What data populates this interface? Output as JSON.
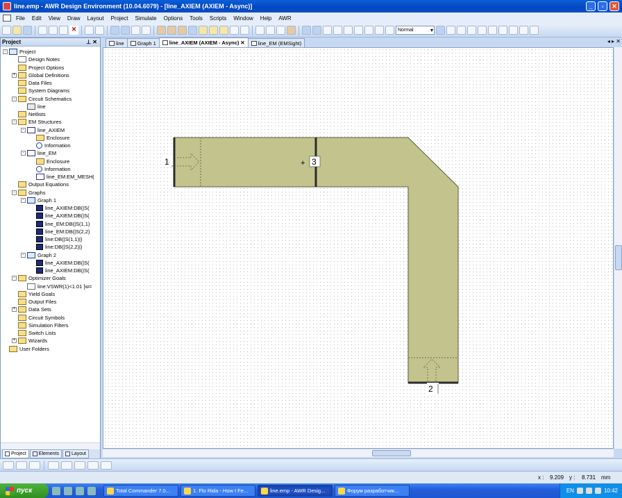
{
  "window": {
    "title": "line.emp - AWR Design Environment (10.04.6079) - [line_AXIEM (AXIEM - Async)]"
  },
  "menubar": {
    "items": [
      "File",
      "Edit",
      "View",
      "Draw",
      "Layout",
      "Project",
      "Simulate",
      "Options",
      "Tools",
      "Scripts",
      "Window",
      "Help",
      "AWR"
    ]
  },
  "toolbar": {
    "view_mode": "Normal"
  },
  "project_pane": {
    "title": "Project",
    "tree": [
      {
        "label": "Project",
        "icon": "project-icon"
      },
      {
        "label": "Design Notes",
        "icon": "doc-icon"
      },
      {
        "label": "Project Options",
        "icon": "folder-icon"
      },
      {
        "label": "Global Definitions",
        "icon": "folder-icon"
      },
      {
        "label": "Data Files",
        "icon": "folder-icon"
      },
      {
        "label": "System Diagrams",
        "icon": "folder-icon"
      },
      {
        "label": "Circuit Schematics",
        "icon": "folder-icon"
      },
      {
        "label": "line",
        "icon": "schematic-icon"
      },
      {
        "label": "Netlists",
        "icon": "folder-icon"
      },
      {
        "label": "EM Structures",
        "icon": "folder-icon"
      },
      {
        "label": "line_AXIEM",
        "icon": "em-icon"
      },
      {
        "label": "Enclosure",
        "icon": "folder-icon"
      },
      {
        "label": "Information",
        "icon": "info-icon"
      },
      {
        "label": "line_EM",
        "icon": "em-icon"
      },
      {
        "label": "Enclosure",
        "icon": "folder-icon"
      },
      {
        "label": "Information",
        "icon": "info-icon"
      },
      {
        "label": "line_EM:EM_MESH(",
        "icon": "em-icon"
      },
      {
        "label": "Output Equations",
        "icon": "folder-icon"
      },
      {
        "label": "Graphs",
        "icon": "folder-icon"
      },
      {
        "label": "Graph 1",
        "icon": "graph-icon"
      },
      {
        "label": "line_AXIEM:DB(|S(",
        "icon": "trace-icon"
      },
      {
        "label": "line_AXIEM:DB(|S(",
        "icon": "trace-icon"
      },
      {
        "label": "line_EM:DB(|S(1,1)",
        "icon": "trace-icon"
      },
      {
        "label": "line_EM:DB(|S(2,2)",
        "icon": "trace-icon"
      },
      {
        "label": "line:DB(|S(1,1)|)",
        "icon": "trace-icon"
      },
      {
        "label": "line:DB(|S(2,2)|)",
        "icon": "trace-icon"
      },
      {
        "label": "Graph 2",
        "icon": "graph-icon"
      },
      {
        "label": "line_AXIEM:DB(|S(",
        "icon": "trace-icon"
      },
      {
        "label": "line_AXIEM:DB(|S(",
        "icon": "trace-icon"
      },
      {
        "label": "Optimizer Goals",
        "icon": "folder-icon"
      },
      {
        "label": "line:VSWR(1)<1.01 [w=",
        "icon": "goal-icon"
      },
      {
        "label": "Yield Goals",
        "icon": "folder-icon"
      },
      {
        "label": "Output Files",
        "icon": "folder-icon"
      },
      {
        "label": "Data Sets",
        "icon": "folder-icon"
      },
      {
        "label": "Circuit Symbols",
        "icon": "folder-icon"
      },
      {
        "label": "Simulation Filters",
        "icon": "folder-icon"
      },
      {
        "label": "Switch Lists",
        "icon": "folder-icon"
      },
      {
        "label": "Wizards",
        "icon": "folder-icon"
      },
      {
        "label": "User Folders",
        "icon": "folder-icon"
      }
    ],
    "tabs": [
      "Project",
      "Elements",
      "Layout"
    ]
  },
  "doc_tabs": [
    "line",
    "Graph 1",
    "line_AXIEM (AXIEM - Async)",
    "line_EM (EMSight)"
  ],
  "layout": {
    "ports": [
      "1",
      "2",
      "3"
    ],
    "conductor_color": "#c3c38d",
    "edge_color": "#2b2b2b"
  },
  "status": {
    "x_label": "x :",
    "x_value": "9.209",
    "y_label": "y :",
    "y_value": "8.731",
    "unit": "mm"
  },
  "taskbar": {
    "start_label": "пуск",
    "tasks": [
      "Total Commander 7.0...",
      "1. Flo Rida - How I Fe...",
      "line.emp - AWR Desig...",
      "Форум разработчик..."
    ],
    "lang": "EN",
    "clock": "10:42"
  }
}
